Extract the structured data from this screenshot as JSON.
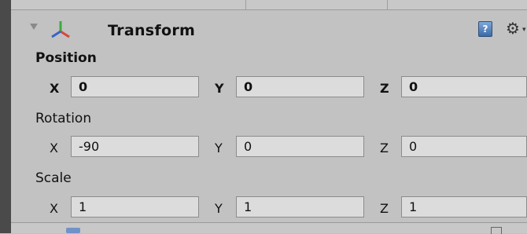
{
  "component": {
    "title": "Transform",
    "help_icon_glyph": "?",
    "gear_glyph": "⚙",
    "gear_caret": "▾"
  },
  "position": {
    "label": "Position",
    "axes": [
      {
        "axis": "X",
        "value": "0"
      },
      {
        "axis": "Y",
        "value": "0"
      },
      {
        "axis": "Z",
        "value": "0"
      }
    ]
  },
  "rotation": {
    "label": "Rotation",
    "axes": [
      {
        "axis": "X",
        "value": "-90"
      },
      {
        "axis": "Y",
        "value": "0"
      },
      {
        "axis": "Z",
        "value": "0"
      }
    ]
  },
  "scale": {
    "label": "Scale",
    "axes": [
      {
        "axis": "X",
        "value": "1"
      },
      {
        "axis": "Y",
        "value": "1"
      },
      {
        "axis": "Z",
        "value": "1"
      }
    ]
  },
  "colors": {
    "panel": "#c2c2c2",
    "field": "#dcdcdc",
    "left_strip": "#4a4a4a",
    "help_blue": "#3a6aa8"
  }
}
